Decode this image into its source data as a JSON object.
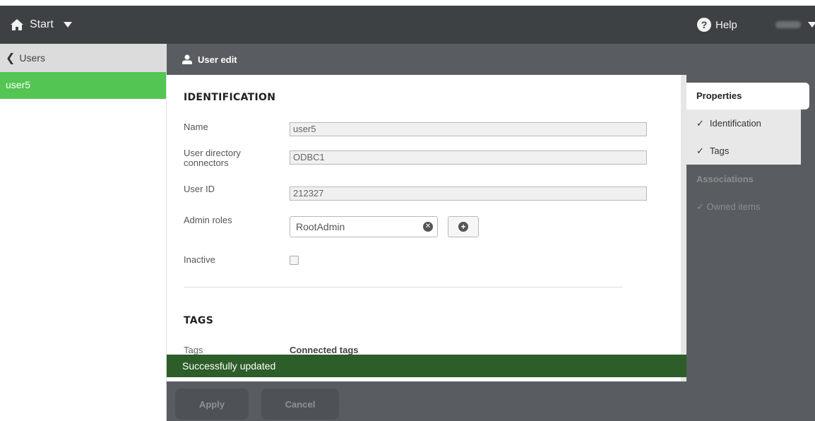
{
  "topbar": {
    "start_label": "Start",
    "help_label": "Help",
    "home_icon": "home-icon",
    "help_icon": "help-icon"
  },
  "left_panel": {
    "back_label": "Users",
    "items": [
      {
        "label": "user5",
        "selected": true
      }
    ]
  },
  "main": {
    "header_title": "User edit",
    "identification": {
      "title": "IDENTIFICATION",
      "name_label": "Name",
      "name_value": "user5",
      "udc_label_line1": "User directory",
      "udc_label_line2": "connectors",
      "udc_value": "ODBC1",
      "userid_label": "User ID",
      "userid_value": "212327",
      "admin_roles_label": "Admin roles",
      "admin_role_value": "RootAdmin",
      "inactive_label": "Inactive"
    },
    "tags": {
      "title": "TAGS",
      "tags_label": "Tags",
      "connected_tags_label": "Connected tags"
    },
    "toast_message": "Successfully updated",
    "apply_label": "Apply",
    "cancel_label": "Cancel"
  },
  "right_panel": {
    "properties_label": "Properties",
    "properties_items": [
      {
        "label": "Identification"
      },
      {
        "label": "Tags"
      }
    ],
    "associations_label": "Associations",
    "associations_items": [
      {
        "label": "Owned items"
      }
    ]
  },
  "colors": {
    "topbar": "#3d4144",
    "selected_item": "#52c552",
    "main_bg": "#595d61",
    "toast": "#2d5e2a"
  }
}
